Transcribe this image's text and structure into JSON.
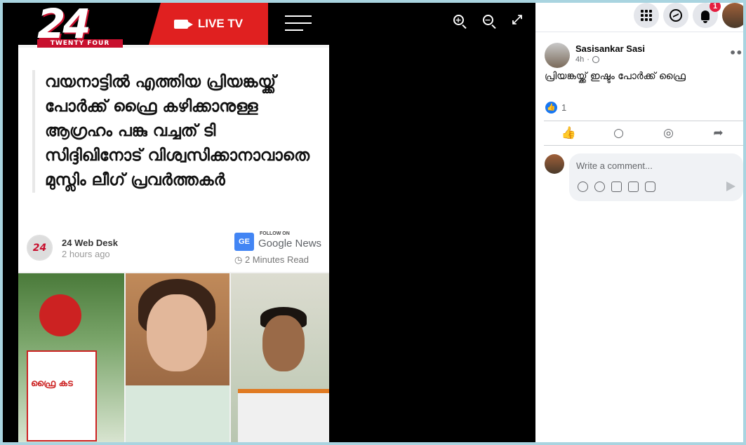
{
  "viewer": {
    "site_logo_number": "24",
    "site_logo_subtitle": "TWENTY FOUR",
    "live_tv_label": "LIVE TV",
    "headline": "വയനാട്ടിൽ എത്തിയ പ്രിയങ്കയ്ക്ക് പോർക്ക് ഫ്രൈ കഴിക്കാനുള്ള ആഗ്രഹം പങ്കു വച്ചത് ടി സിദ്ദിഖിനോട് വിശ്വസിക്കാനാവാതെ മുസ്ലിം ലീഗ് പ്രവർത്തകർ",
    "author_avatar_text": "24",
    "author_name": "24 Web Desk",
    "author_time": "2 hours ago",
    "follow_on": "FOLLOW ON",
    "google_news": "Google News",
    "ge_badge": "GE",
    "read_time": "2 Minutes Read",
    "sign_text": "ഫ്രൈ കട",
    "icons": {
      "zoom_in": "zoom-in-icon",
      "zoom_out": "zoom-out-icon",
      "fullscreen": "fullscreen-icon"
    }
  },
  "panel": {
    "notification_count": "1",
    "post": {
      "author": "Sasisankar Sasi",
      "time": "4h",
      "more": "•••",
      "text": "പ്രിയങ്കയ്ക്ക് ഇഷ്ടം പോർക്ക് ഫ്രൈ",
      "like_count": "1"
    },
    "comment": {
      "placeholder": "Write a comment..."
    }
  },
  "colors": {
    "brand_red": "#e02020",
    "facebook_blue": "#1877f2",
    "badge_red": "#e41e3f"
  }
}
